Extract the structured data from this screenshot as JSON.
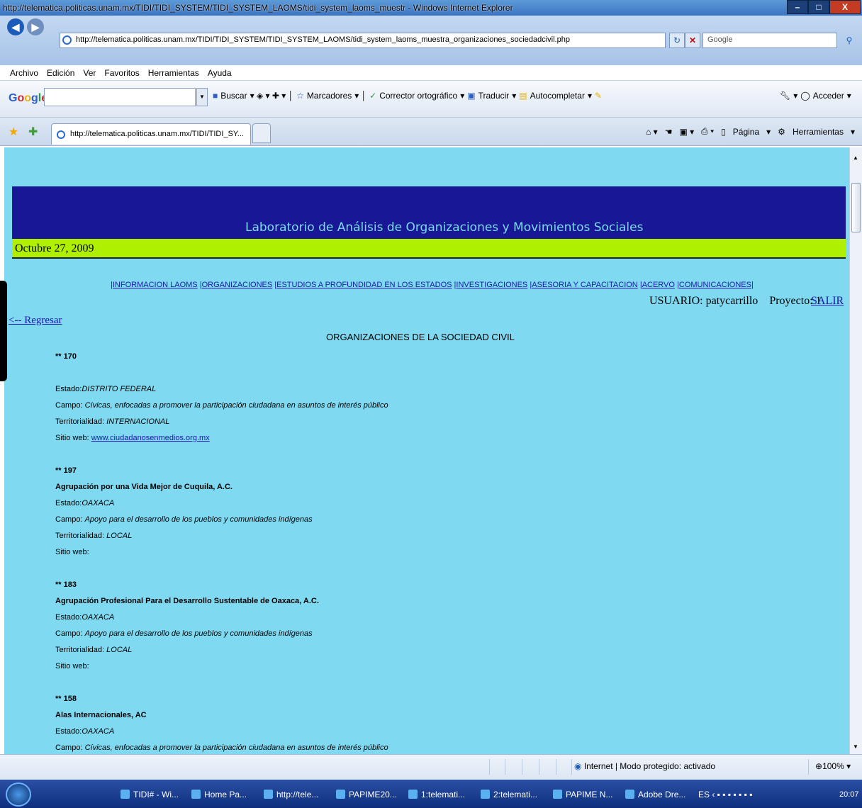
{
  "window": {
    "title": "http://telematica.politicas.unam.mx/TIDI/TIDI_SYSTEM/TIDI_SYSTEM_LAOMS/tidi_system_laoms_muestr - Windows Internet Explorer"
  },
  "address": {
    "url": "http://telematica.politicas.unam.mx/TIDI/TIDI_SYSTEM/TIDI_SYSTEM_LAOMS/tidi_system_laoms_muestra_organizaciones_sociedadcivil.php",
    "search_placeholder": "Google"
  },
  "menu": [
    "Archivo",
    "Edición",
    "Ver",
    "Favoritos",
    "Herramientas",
    "Ayuda"
  ],
  "google_toolbar": {
    "logo": "Google",
    "buscar": "Buscar",
    "marcadores": "Marcadores",
    "corrector": "Corrector ortográfico",
    "traducir": "Traducir",
    "autocompletar": "Autocompletar",
    "acceder": "Acceder"
  },
  "tab": {
    "title": "http://telematica.politicas.unam.mx/TIDI/TIDI_SY..."
  },
  "command_bar": {
    "pagina": "Página",
    "herramientas": "Herramientas"
  },
  "page": {
    "banner_title": "Laboratorio de Análisis de Organizaciones y Movimientos Sociales",
    "date": "Octubre 27, 2009",
    "nav_links": [
      "INFORMACION LAOMS",
      "ORGANIZACIONES",
      "ESTUDIOS A PROFUNDIDAD EN LOS ESTADOS",
      "INVESTIGACIONES",
      "ASESORIA Y CAPACITACION",
      "ACERVO",
      "COMUNICACIONES"
    ],
    "user_label": "USUARIO: patycarrillo",
    "project_label": "Proyecto: 1",
    "logout": "SALIR",
    "back_link": "<-- Regresar",
    "heading": "ORGANIZACIONES DE LA SOCIEDAD CIVIL",
    "labels": {
      "estado": "Estado:",
      "campo": "Campo: ",
      "territorialidad": "Territorialidad: ",
      "sitio": "Sitio web: "
    },
    "entries": [
      {
        "num": "** 170",
        "name": "",
        "estado": "DISTRITO FEDERAL",
        "campo": "Cívicas, enfocadas a promover la participación ciudadana en asuntos de interés público",
        "territorialidad": "INTERNACIONAL",
        "sitio": "www.ciudadanosenmedios.org.mx"
      },
      {
        "num": "** 197",
        "name": "Agrupación por una Vida Mejor de Cuquila, A.C.",
        "estado": "OAXACA",
        "campo": "Apoyo para el desarrollo de los pueblos y comunidades indígenas",
        "territorialidad": "LOCAL",
        "sitio": ""
      },
      {
        "num": "** 183",
        "name": "Agrupación Profesional Para el Desarrollo Sustentable de Oaxaca, A.C.",
        "estado": "OAXACA",
        "campo": "Apoyo para el desarrollo de los pueblos y comunidades indígenas",
        "territorialidad": "LOCAL",
        "sitio": ""
      },
      {
        "num": "** 158",
        "name": "Alas Internacionales, AC",
        "estado": "OAXACA",
        "campo": "Cívicas, enfocadas a promover la participación ciudadana en asuntos de interés público",
        "territorialidad": "",
        "sitio": ""
      }
    ]
  },
  "status": {
    "zone": "Internet | Modo protegido: activado",
    "zoom": "100%"
  },
  "taskbar": {
    "items": [
      "TIDI# - Wi...",
      "Home Pa...",
      "http://tele...",
      "PAPIME20...",
      "1:telemati...",
      "2:telemati...",
      "PAPIME N...",
      "Adobe Dre..."
    ],
    "lang": "ES",
    "clock": "20:07"
  }
}
